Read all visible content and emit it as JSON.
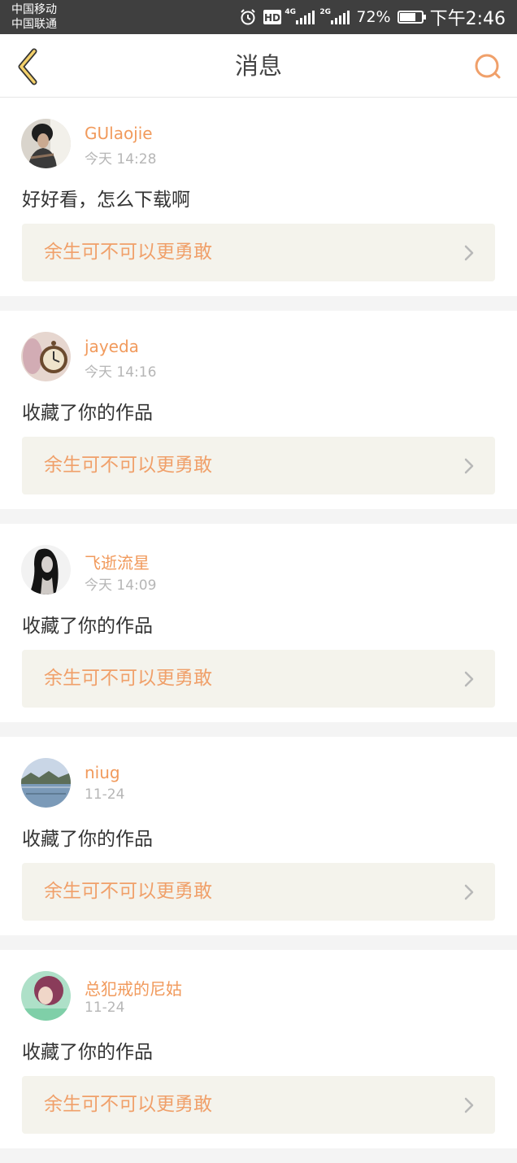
{
  "status_bar": {
    "carrier_1": "中国移动",
    "carrier_2": "中国联通",
    "net_1": "4G",
    "net_2": "2G",
    "hd": "HD",
    "battery_percent": "72%",
    "battery_level": 0.72,
    "time": "下午2:46"
  },
  "header": {
    "title": "消息",
    "back_icon": "chevron-left-icon",
    "search_icon": "search-icon"
  },
  "colors": {
    "accent": "#f19a5c",
    "link_bg": "#f4f3ec",
    "timestamp": "#b6b6b6"
  },
  "messages": [
    {
      "username": "GUlaojie",
      "time": "今天 14:28",
      "text": "好好看，怎么下载啊",
      "work_title": "余生可不可以更勇敢"
    },
    {
      "username": "jayeda",
      "time": "今天 14:16",
      "text": "收藏了你的作品",
      "work_title": "余生可不可以更勇敢"
    },
    {
      "username": "飞逝流星",
      "time": "今天 14:09",
      "text": "收藏了你的作品",
      "work_title": "余生可不可以更勇敢"
    },
    {
      "username": "niug",
      "time": "11-24",
      "text": "收藏了你的作品",
      "work_title": "余生可不可以更勇敢"
    },
    {
      "username": "总犯戒的尼姑",
      "time": "11-24",
      "text": "收藏了你的作品",
      "work_title": "余生可不可以更勇敢"
    }
  ]
}
